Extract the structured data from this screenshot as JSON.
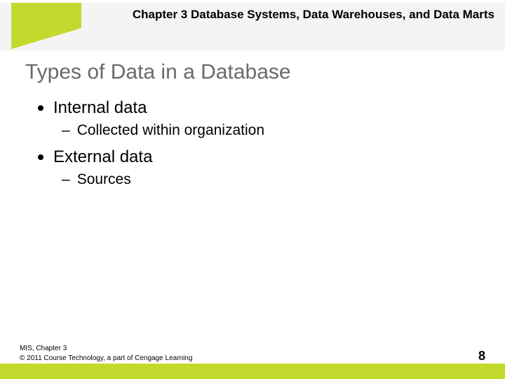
{
  "header": {
    "chapter_title": "Chapter 3 Database Systems, Data Warehouses, and Data Marts"
  },
  "title": "Types of Data in a Database",
  "bullets": [
    {
      "text": "Internal data",
      "sub": "Collected within organization"
    },
    {
      "text": "External data",
      "sub": "Sources"
    }
  ],
  "footer": {
    "line1": "MIS, Chapter 3",
    "line2": "© 2011 Course Technology, a part of Cengage Learning",
    "page": "8"
  }
}
